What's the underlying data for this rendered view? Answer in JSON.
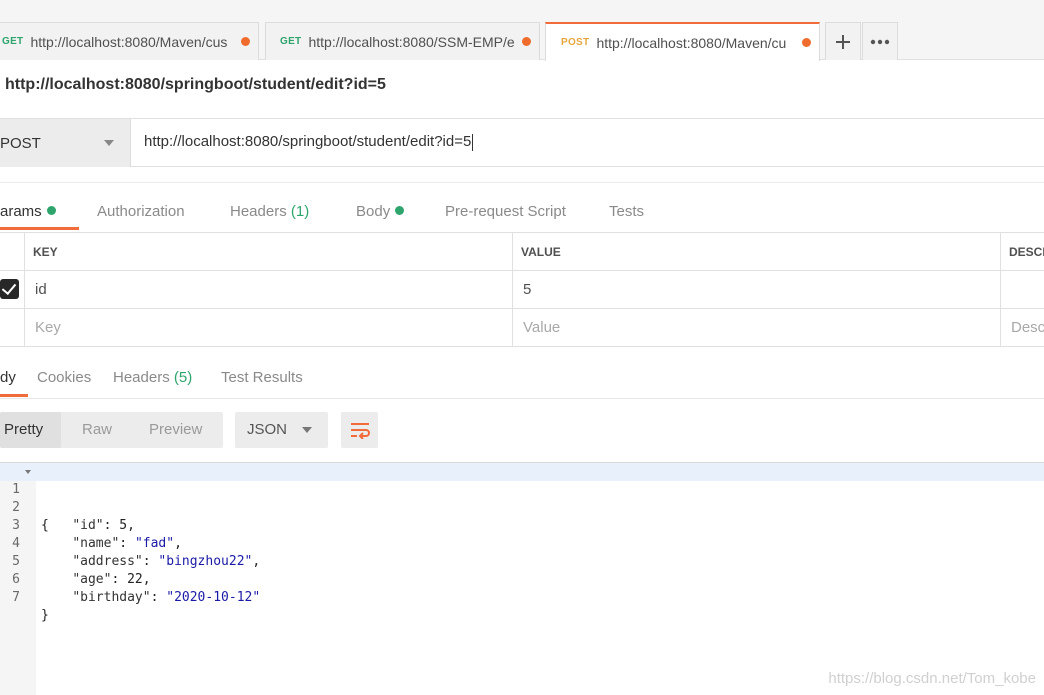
{
  "tabs": [
    {
      "method": "GET",
      "url": "http://localhost:8080/Maven/cus"
    },
    {
      "method": "GET",
      "url": "http://localhost:8080/SSM-EMP/e"
    },
    {
      "method": "POST",
      "url": "http://localhost:8080/Maven/cu"
    }
  ],
  "tab_controls": {
    "add_icon": "plus-icon",
    "more_icon": "more-horizontal-icon"
  },
  "request": {
    "title": "http://localhost:8080/springboot/student/edit?id=5",
    "method": "POST",
    "url": "http://localhost:8080/springboot/student/edit?id=5"
  },
  "request_tabs": {
    "params": "arams",
    "authorization": "Authorization",
    "headers": "Headers",
    "headers_count": "(1)",
    "body": "Body",
    "pre_request": "Pre-request Script",
    "tests": "Tests"
  },
  "params_table": {
    "headers": {
      "key": "KEY",
      "value": "VALUE",
      "description": "DESCR"
    },
    "rows": [
      {
        "key": "id",
        "value": "5",
        "description": ""
      }
    ],
    "placeholders": {
      "key": "Key",
      "value": "Value",
      "description": "Desc"
    }
  },
  "response_tabs": {
    "body": "dy",
    "cookies": "Cookies",
    "headers": "Headers",
    "headers_count": "(5)",
    "test_results": "Test Results"
  },
  "response_toolbar": {
    "pretty": "Pretty",
    "raw": "Raw",
    "preview": "Preview",
    "format": "JSON",
    "wrap_icon": "wrap-lines-icon"
  },
  "code": {
    "line_numbers": [
      "1",
      "2",
      "3",
      "4",
      "5",
      "6",
      "7"
    ],
    "open_brace": "{",
    "close_brace": "}",
    "fields": [
      {
        "key": "\"id\"",
        "value": "5",
        "type": "number",
        "comma": ","
      },
      {
        "key": "\"name\"",
        "value": "\"fad\"",
        "type": "string",
        "comma": ","
      },
      {
        "key": "\"address\"",
        "value": "\"bingzhou22\"",
        "type": "string",
        "comma": ","
      },
      {
        "key": "\"age\"",
        "value": "22",
        "type": "number",
        "comma": ","
      },
      {
        "key": "\"birthday\"",
        "value": "\"2020-10-12\"",
        "type": "string",
        "comma": ""
      }
    ]
  },
  "watermark": "https://blog.csdn.net/Tom_kobe",
  "colors": {
    "accent": "#f26b3a",
    "green": "#2ea56d",
    "get": "#2ea56d",
    "post": "#e5a73c",
    "string": "#1a1aa6"
  }
}
